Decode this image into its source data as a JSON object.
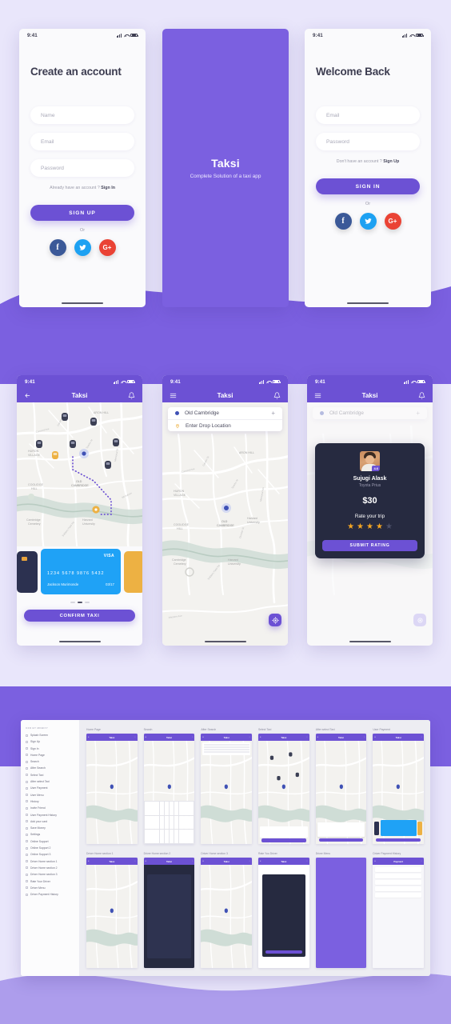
{
  "theme": {
    "purple": "#6C51D4",
    "purple_light": "#7B60E0",
    "background": "#E9E6FB",
    "dark_card": "#262A40",
    "amber": "#F5A623",
    "visa_blue": "#1FA2F6"
  },
  "status_bar": {
    "time": "9:41"
  },
  "screens": {
    "signup": {
      "title": "Create an account",
      "fields": [
        {
          "name": "name",
          "placeholder": "Name"
        },
        {
          "name": "email",
          "placeholder": "Email"
        },
        {
          "name": "password",
          "placeholder": "Password"
        }
      ],
      "hint_text": "Already have an account ?",
      "hint_link": "Sign In",
      "cta": "SIGN UP",
      "or": "Or",
      "socials": [
        "facebook",
        "twitter",
        "google-plus"
      ]
    },
    "splash": {
      "brand": "Taksi",
      "tagline": "Complete Solution of a taxi app"
    },
    "signin": {
      "title": "Welcome Back",
      "fields": [
        {
          "name": "email",
          "placeholder": "Email"
        },
        {
          "name": "password",
          "placeholder": "Password"
        }
      ],
      "hint_text": "Don't have an account ?",
      "hint_link": "Sign Up",
      "cta": "SIGN IN",
      "or": "Or",
      "socials": [
        "facebook",
        "twitter",
        "google-plus"
      ]
    },
    "payment": {
      "appbar_title": "Taksi",
      "card": {
        "brand": "VISA",
        "number": "1234  5678  9876  5432",
        "holder": "Jackson Murimonde",
        "expiry": "03/17"
      },
      "cta": "CONFIRM TAXI"
    },
    "search": {
      "appbar_title": "Taksi",
      "pickup": "Old Cambridge",
      "pickup_action": "+",
      "drop_placeholder": "Enter Drop Location"
    },
    "rating": {
      "appbar_title": "Taksi",
      "pickup": "Old Cambridge",
      "driver_name": "Sujugi Alask",
      "driver_car": "Toyota Prius",
      "driver_score": "4.6",
      "price": "$30",
      "rate_label": "Rate your trip",
      "stars_filled": 4,
      "stars_total": 5,
      "cta": "SUBMIT RATING"
    }
  },
  "map_labels": {
    "regions": [
      "ARON HILL",
      "HURON VILLAGE",
      "OLD CAMBRIDGE",
      "COOLIDGE HILL",
      "Cambridge Cemetery",
      "Harvard University"
    ],
    "streets": [
      "Concord Ave",
      "Garden St",
      "Huron Ave",
      "Sparks St",
      "Brattle St",
      "Mt Auburn St",
      "Memorial Dr",
      "Western Ave",
      "Soldiers Field Rd",
      "Raymond St",
      "Dunster St"
    ]
  },
  "showcase": {
    "sidebar_heading": "UXD BY MOBIFY",
    "sidebar_items": [
      "Splash Screen",
      "Sign Up",
      "Sign In",
      "Home Page",
      "Search",
      "After Search",
      "Select Taxi",
      "After select Taxi",
      "User Payment",
      "User Menu",
      "History",
      "Invite Friend",
      "User Payment History",
      "Add your card",
      "Save Money",
      "Settings",
      "Online Support",
      "Online Support 2",
      "Online Support 3",
      "Driver Home section  1",
      "Driver Home section  2",
      "Driver Home section  3",
      "Rate Your Driver",
      "Driver Menu",
      "Driver Payment History"
    ],
    "rows": [
      {
        "cells": [
          {
            "caption": "Home Page",
            "kind": "map",
            "title": "Taksi"
          },
          {
            "caption": "Search",
            "kind": "keyboard",
            "title": "Taksi"
          },
          {
            "caption": "After Search",
            "kind": "list",
            "title": "Taksi"
          },
          {
            "caption": "Select Taxi",
            "kind": "map-cars",
            "title": "Taksi"
          },
          {
            "caption": "After select Taxi",
            "kind": "driver",
            "title": "Taksi"
          },
          {
            "caption": "User Payment",
            "kind": "cards",
            "title": "Taksi"
          }
        ]
      },
      {
        "cells": [
          {
            "caption": "Driver Home section  1",
            "kind": "map",
            "title": "Taksi"
          },
          {
            "caption": "Driver Home section  2",
            "kind": "confirm",
            "title": "Taksi"
          },
          {
            "caption": "Driver Home section  3",
            "kind": "map",
            "title": "Taksi"
          },
          {
            "caption": "Rate You Driver",
            "kind": "rating",
            "title": "Taksi"
          },
          {
            "caption": "Driver Menu",
            "kind": "menu",
            "title": ""
          },
          {
            "caption": "Driver Payment History",
            "kind": "history",
            "title": "Payment"
          }
        ]
      }
    ]
  }
}
